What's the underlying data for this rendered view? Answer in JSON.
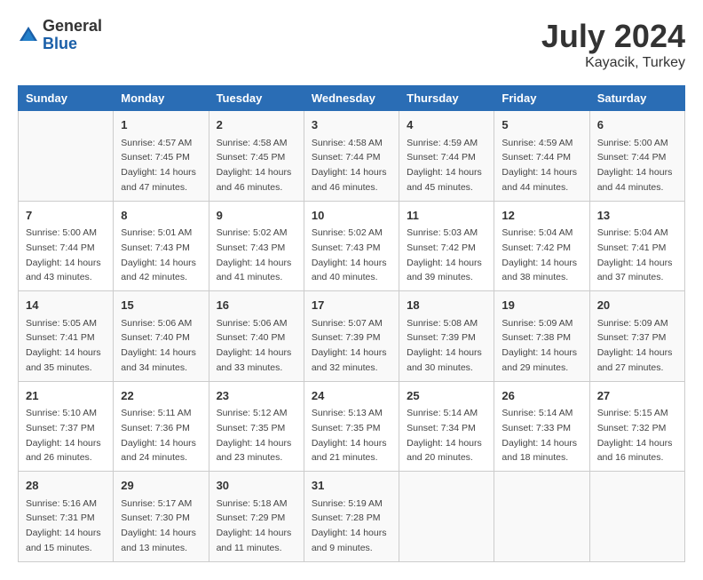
{
  "header": {
    "logo_general": "General",
    "logo_blue": "Blue",
    "month_year": "July 2024",
    "location": "Kayacik, Turkey"
  },
  "days_of_week": [
    "Sunday",
    "Monday",
    "Tuesday",
    "Wednesday",
    "Thursday",
    "Friday",
    "Saturday"
  ],
  "weeks": [
    [
      {
        "day": "",
        "sunrise": "",
        "sunset": "",
        "daylight": ""
      },
      {
        "day": "1",
        "sunrise": "4:57 AM",
        "sunset": "7:45 PM",
        "daylight": "14 hours and 47 minutes."
      },
      {
        "day": "2",
        "sunrise": "4:58 AM",
        "sunset": "7:45 PM",
        "daylight": "14 hours and 46 minutes."
      },
      {
        "day": "3",
        "sunrise": "4:58 AM",
        "sunset": "7:44 PM",
        "daylight": "14 hours and 46 minutes."
      },
      {
        "day": "4",
        "sunrise": "4:59 AM",
        "sunset": "7:44 PM",
        "daylight": "14 hours and 45 minutes."
      },
      {
        "day": "5",
        "sunrise": "4:59 AM",
        "sunset": "7:44 PM",
        "daylight": "14 hours and 44 minutes."
      },
      {
        "day": "6",
        "sunrise": "5:00 AM",
        "sunset": "7:44 PM",
        "daylight": "14 hours and 44 minutes."
      }
    ],
    [
      {
        "day": "7",
        "sunrise": "5:00 AM",
        "sunset": "7:44 PM",
        "daylight": "14 hours and 43 minutes."
      },
      {
        "day": "8",
        "sunrise": "5:01 AM",
        "sunset": "7:43 PM",
        "daylight": "14 hours and 42 minutes."
      },
      {
        "day": "9",
        "sunrise": "5:02 AM",
        "sunset": "7:43 PM",
        "daylight": "14 hours and 41 minutes."
      },
      {
        "day": "10",
        "sunrise": "5:02 AM",
        "sunset": "7:43 PM",
        "daylight": "14 hours and 40 minutes."
      },
      {
        "day": "11",
        "sunrise": "5:03 AM",
        "sunset": "7:42 PM",
        "daylight": "14 hours and 39 minutes."
      },
      {
        "day": "12",
        "sunrise": "5:04 AM",
        "sunset": "7:42 PM",
        "daylight": "14 hours and 38 minutes."
      },
      {
        "day": "13",
        "sunrise": "5:04 AM",
        "sunset": "7:41 PM",
        "daylight": "14 hours and 37 minutes."
      }
    ],
    [
      {
        "day": "14",
        "sunrise": "5:05 AM",
        "sunset": "7:41 PM",
        "daylight": "14 hours and 35 minutes."
      },
      {
        "day": "15",
        "sunrise": "5:06 AM",
        "sunset": "7:40 PM",
        "daylight": "14 hours and 34 minutes."
      },
      {
        "day": "16",
        "sunrise": "5:06 AM",
        "sunset": "7:40 PM",
        "daylight": "14 hours and 33 minutes."
      },
      {
        "day": "17",
        "sunrise": "5:07 AM",
        "sunset": "7:39 PM",
        "daylight": "14 hours and 32 minutes."
      },
      {
        "day": "18",
        "sunrise": "5:08 AM",
        "sunset": "7:39 PM",
        "daylight": "14 hours and 30 minutes."
      },
      {
        "day": "19",
        "sunrise": "5:09 AM",
        "sunset": "7:38 PM",
        "daylight": "14 hours and 29 minutes."
      },
      {
        "day": "20",
        "sunrise": "5:09 AM",
        "sunset": "7:37 PM",
        "daylight": "14 hours and 27 minutes."
      }
    ],
    [
      {
        "day": "21",
        "sunrise": "5:10 AM",
        "sunset": "7:37 PM",
        "daylight": "14 hours and 26 minutes."
      },
      {
        "day": "22",
        "sunrise": "5:11 AM",
        "sunset": "7:36 PM",
        "daylight": "14 hours and 24 minutes."
      },
      {
        "day": "23",
        "sunrise": "5:12 AM",
        "sunset": "7:35 PM",
        "daylight": "14 hours and 23 minutes."
      },
      {
        "day": "24",
        "sunrise": "5:13 AM",
        "sunset": "7:35 PM",
        "daylight": "14 hours and 21 minutes."
      },
      {
        "day": "25",
        "sunrise": "5:14 AM",
        "sunset": "7:34 PM",
        "daylight": "14 hours and 20 minutes."
      },
      {
        "day": "26",
        "sunrise": "5:14 AM",
        "sunset": "7:33 PM",
        "daylight": "14 hours and 18 minutes."
      },
      {
        "day": "27",
        "sunrise": "5:15 AM",
        "sunset": "7:32 PM",
        "daylight": "14 hours and 16 minutes."
      }
    ],
    [
      {
        "day": "28",
        "sunrise": "5:16 AM",
        "sunset": "7:31 PM",
        "daylight": "14 hours and 15 minutes."
      },
      {
        "day": "29",
        "sunrise": "5:17 AM",
        "sunset": "7:30 PM",
        "daylight": "14 hours and 13 minutes."
      },
      {
        "day": "30",
        "sunrise": "5:18 AM",
        "sunset": "7:29 PM",
        "daylight": "14 hours and 11 minutes."
      },
      {
        "day": "31",
        "sunrise": "5:19 AM",
        "sunset": "7:28 PM",
        "daylight": "14 hours and 9 minutes."
      },
      {
        "day": "",
        "sunrise": "",
        "sunset": "",
        "daylight": ""
      },
      {
        "day": "",
        "sunrise": "",
        "sunset": "",
        "daylight": ""
      },
      {
        "day": "",
        "sunrise": "",
        "sunset": "",
        "daylight": ""
      }
    ]
  ]
}
